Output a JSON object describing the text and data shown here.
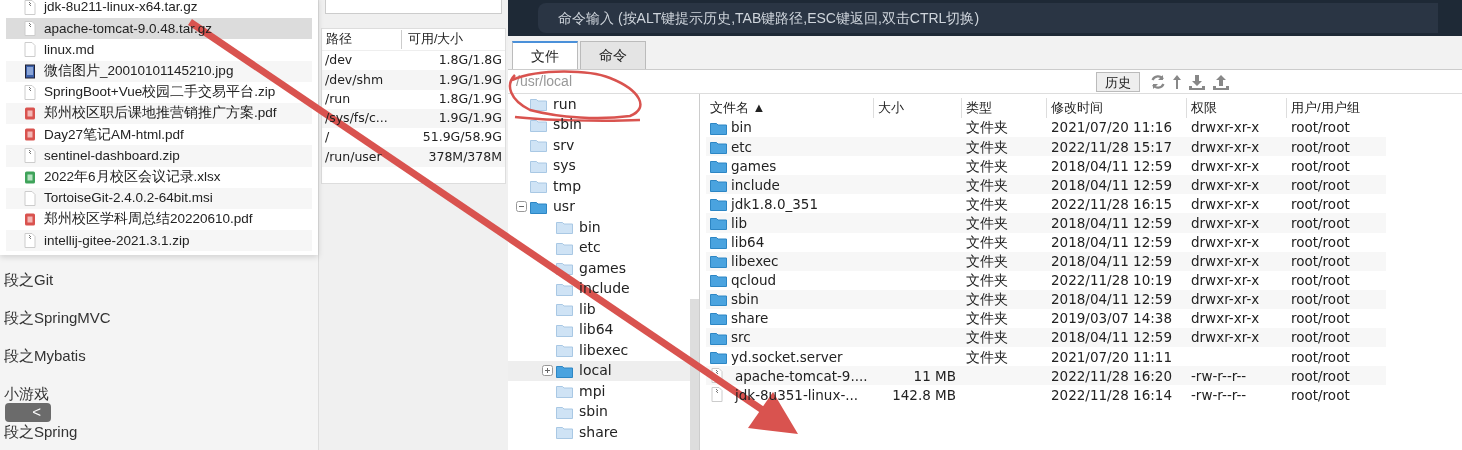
{
  "finder_files": [
    {
      "name": "jdk-8u211-linux-x64.tar.gz",
      "kind": "archive",
      "selected": false
    },
    {
      "name": "apache-tomcat-9.0.48.tar.gz",
      "kind": "archive",
      "selected": true
    },
    {
      "name": "linux.md",
      "kind": "doc",
      "selected": false
    },
    {
      "name": "微信图片_20010101145210.jpg",
      "kind": "image",
      "selected": false
    },
    {
      "name": "SpringBoot+Vue校园二手交易平台.zip",
      "kind": "archive",
      "selected": false
    },
    {
      "name": "郑州校区职后课地推营销推广方案.pdf",
      "kind": "pdf",
      "selected": false
    },
    {
      "name": "Day27笔记AM-html.pdf",
      "kind": "pdf",
      "selected": false
    },
    {
      "name": "sentinel-dashboard.zip",
      "kind": "archive",
      "selected": false
    },
    {
      "name": "2022年6月校区会议记录.xlsx",
      "kind": "sheet",
      "selected": false
    },
    {
      "name": "TortoiseGit-2.4.0.2-64bit.msi",
      "kind": "doc",
      "selected": false
    },
    {
      "name": "郑州校区学科周总结20220610.pdf",
      "kind": "pdf",
      "selected": false
    },
    {
      "name": "intellij-gitee-2021.3.1.zip",
      "kind": "archive",
      "selected": false
    }
  ],
  "notes_list": [
    "段之Git",
    "段之SpringMVC",
    "段之Mybatis",
    "小游戏",
    "段之Spring"
  ],
  "back_button": {
    "label": "<"
  },
  "disks": {
    "columns": [
      "路径",
      "可用/大小"
    ],
    "rows": [
      [
        "/dev",
        "1.8G/1.8G"
      ],
      [
        "/dev/shm",
        "1.9G/1.9G"
      ],
      [
        "/run",
        "1.8G/1.9G"
      ],
      [
        "/sys/fs/c...",
        "1.9G/1.9G"
      ],
      [
        "/",
        "51.9G/58.9G"
      ],
      [
        "/run/user",
        "378M/378M"
      ]
    ]
  },
  "command_bar": {
    "placeholder": "命令输入 (按ALT键提示历史,TAB键路径,ESC键返回,双击CTRL切换)"
  },
  "tabs": [
    {
      "label": "文件",
      "selected": true
    },
    {
      "label": "命令",
      "selected": false
    }
  ],
  "path_bar": {
    "value": "/usr/local",
    "history_button": "历史"
  },
  "tree": [
    {
      "name": "run"
    },
    {
      "name": "sbin"
    },
    {
      "name": "srv"
    },
    {
      "name": "sys"
    },
    {
      "name": "tmp"
    },
    {
      "name": "usr",
      "expanded": true,
      "selected": false,
      "children": [
        {
          "name": "bin"
        },
        {
          "name": "etc"
        },
        {
          "name": "games"
        },
        {
          "name": "include"
        },
        {
          "name": "lib"
        },
        {
          "name": "lib64"
        },
        {
          "name": "libexec"
        },
        {
          "name": "local",
          "expanded": false,
          "selected": true
        },
        {
          "name": "mpi"
        },
        {
          "name": "sbin"
        },
        {
          "name": "share"
        }
      ]
    }
  ],
  "file_table": {
    "columns": [
      "文件名 ▲",
      "大小",
      "类型",
      "修改时间",
      "权限",
      "用户/用户组"
    ],
    "rows": [
      {
        "kind": "folder",
        "cells": [
          "bin",
          "",
          "文件夹",
          "2021/07/20 11:16",
          "drwxr-xr-x",
          "root/root"
        ]
      },
      {
        "kind": "folder",
        "cells": [
          "etc",
          "",
          "文件夹",
          "2022/11/28 15:17",
          "drwxr-xr-x",
          "root/root"
        ]
      },
      {
        "kind": "folder",
        "cells": [
          "games",
          "",
          "文件夹",
          "2018/04/11 12:59",
          "drwxr-xr-x",
          "root/root"
        ]
      },
      {
        "kind": "folder",
        "cells": [
          "include",
          "",
          "文件夹",
          "2018/04/11 12:59",
          "drwxr-xr-x",
          "root/root"
        ]
      },
      {
        "kind": "folder",
        "cells": [
          "jdk1.8.0_351",
          "",
          "文件夹",
          "2022/11/28 16:15",
          "drwxr-xr-x",
          "root/root"
        ]
      },
      {
        "kind": "folder",
        "cells": [
          "lib",
          "",
          "文件夹",
          "2018/04/11 12:59",
          "drwxr-xr-x",
          "root/root"
        ]
      },
      {
        "kind": "folder",
        "cells": [
          "lib64",
          "",
          "文件夹",
          "2018/04/11 12:59",
          "drwxr-xr-x",
          "root/root"
        ]
      },
      {
        "kind": "folder",
        "cells": [
          "libexec",
          "",
          "文件夹",
          "2018/04/11 12:59",
          "drwxr-xr-x",
          "root/root"
        ]
      },
      {
        "kind": "folder",
        "cells": [
          "qcloud",
          "",
          "文件夹",
          "2022/11/28 10:19",
          "drwxr-xr-x",
          "root/root"
        ]
      },
      {
        "kind": "folder",
        "cells": [
          "sbin",
          "",
          "文件夹",
          "2018/04/11 12:59",
          "drwxr-xr-x",
          "root/root"
        ]
      },
      {
        "kind": "folder",
        "cells": [
          "share",
          "",
          "文件夹",
          "2019/03/07 14:38",
          "drwxr-xr-x",
          "root/root"
        ]
      },
      {
        "kind": "folder",
        "cells": [
          "src",
          "",
          "文件夹",
          "2018/04/11 12:59",
          "drwxr-xr-x",
          "root/root"
        ]
      },
      {
        "kind": "folder",
        "cells": [
          "yd.socket.server",
          "",
          "文件夹",
          "2021/07/20 11:11",
          "",
          "root/root"
        ]
      },
      {
        "kind": "file",
        "cells": [
          "apache-tomcat-9....",
          "11 MB",
          "",
          "2022/11/28 16:20",
          "-rw-r--r--",
          "root/root"
        ]
      },
      {
        "kind": "file",
        "cells": [
          "jdk-8u351-linux-...",
          "142.8 MB",
          "",
          "2022/11/28 16:14",
          "-rw-r--r--",
          "root/root"
        ]
      }
    ]
  },
  "annotations": {
    "arrow": true,
    "circle": true
  }
}
